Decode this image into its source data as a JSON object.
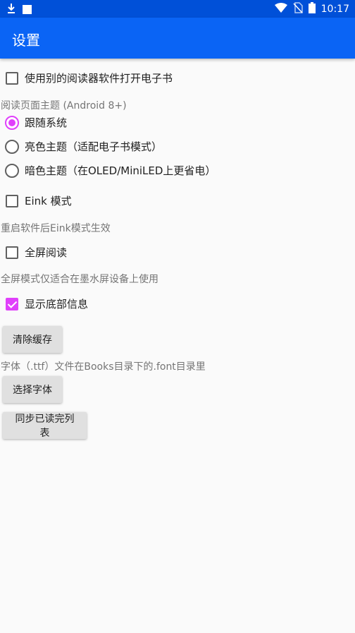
{
  "status_bar": {
    "time": "10:17",
    "icons": [
      "download-icon",
      "notification-square-icon",
      "wifi-icon",
      "no-sim-icon",
      "battery-icon"
    ]
  },
  "app_bar": {
    "title": "设置"
  },
  "settings": {
    "open_with_other_reader": {
      "label": "使用别的阅读器软件打开电子书",
      "checked": false
    },
    "theme_section_title": "阅读页面主题 (Android 8+)",
    "theme_options": [
      {
        "label": "跟随系统",
        "selected": true
      },
      {
        "label": "亮色主题（适配电子书模式）",
        "selected": false
      },
      {
        "label": "暗色主题（在OLED/MiniLED上更省电）",
        "selected": false
      }
    ],
    "eink_mode": {
      "label": "Eink 模式",
      "checked": false
    },
    "eink_hint": "重启软件后Eink模式生效",
    "fullscreen": {
      "label": "全屏阅读",
      "checked": false
    },
    "fullscreen_hint": "全屏模式仅适合在墨水屏设备上使用",
    "show_bottom_info": {
      "label": "显示底部信息",
      "checked": true
    },
    "clear_cache_label": "清除缓存",
    "font_hint": "字体（.ttf）文件在Books目录下的.font目录里",
    "select_font_label": "选择字体",
    "sync_read_list_label": "同步已读完列表"
  },
  "colors": {
    "status_bar": "#0050d8",
    "app_bar": "#0a64f5",
    "accent": "#e040fb",
    "background": "#fafafa"
  }
}
